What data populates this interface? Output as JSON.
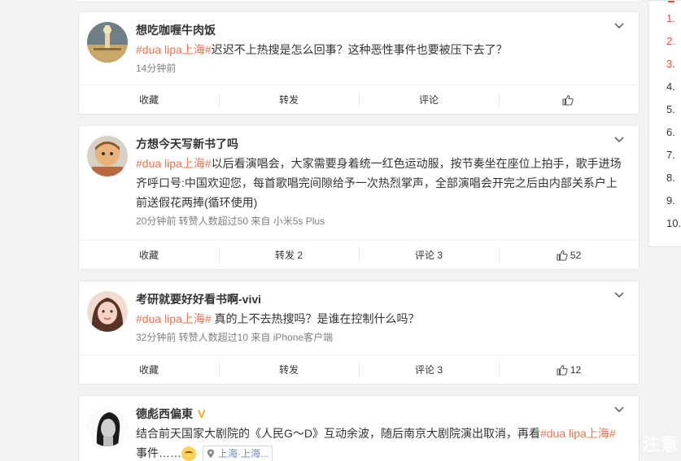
{
  "posts": [
    {
      "username": "想吃咖喱牛肉饭",
      "verified": false,
      "tag": "#dua lipa上海#",
      "text": "迟迟不上热搜是怎么回事？这种恶性事件也要被压下去了？",
      "meta": "14分钟前",
      "actions": {
        "collect": "收藏",
        "repost": "转发",
        "comment": "评论",
        "like": ""
      }
    },
    {
      "username": "方想今天写新书了吗",
      "verified": false,
      "tag": "#dua lipa上海#",
      "text": "以后看演唱会，大家需要身着统一红色运动服，按节奏坐在座位上拍手，歌手进场齐呼口号:中国欢迎您，每首歌唱完间隙给予一次热烈掌声，全部演唱会开完之后由内部关系户上前送假花两捧(循环使用)",
      "meta": "20分钟前 转赞人数超过50 来自 小米5s Plus",
      "actions": {
        "collect": "收藏",
        "repost": "转发 2",
        "comment": "评论 3",
        "like": "52"
      }
    },
    {
      "username": "考研就要好好看书啊-vivi",
      "verified": false,
      "tag": "#dua lipa上海#",
      "text": " 真的上不去热搜吗？是谁在控制什么吗？",
      "meta": "32分钟前 转赞人数超过10 来自 iPhone客户端",
      "actions": {
        "collect": "收藏",
        "repost": "转发",
        "comment": "评论 3",
        "like": "12"
      }
    },
    {
      "username": "德彪西偏東",
      "verified": true,
      "verified_mark": "V",
      "text_before": "结合前天国家大剧院的《人民G～D》互动余波，随后南京大剧院演出取消，再看",
      "tag": "#dua lipa上海#",
      "text_after": "事件……",
      "location": "上海·上海..."
    }
  ],
  "sidebar": {
    "items": [
      "1.",
      "2.",
      "3.",
      "4.",
      "5.",
      "6.",
      "7.",
      "8.",
      "9.",
      "10."
    ]
  },
  "watermark": "注意"
}
